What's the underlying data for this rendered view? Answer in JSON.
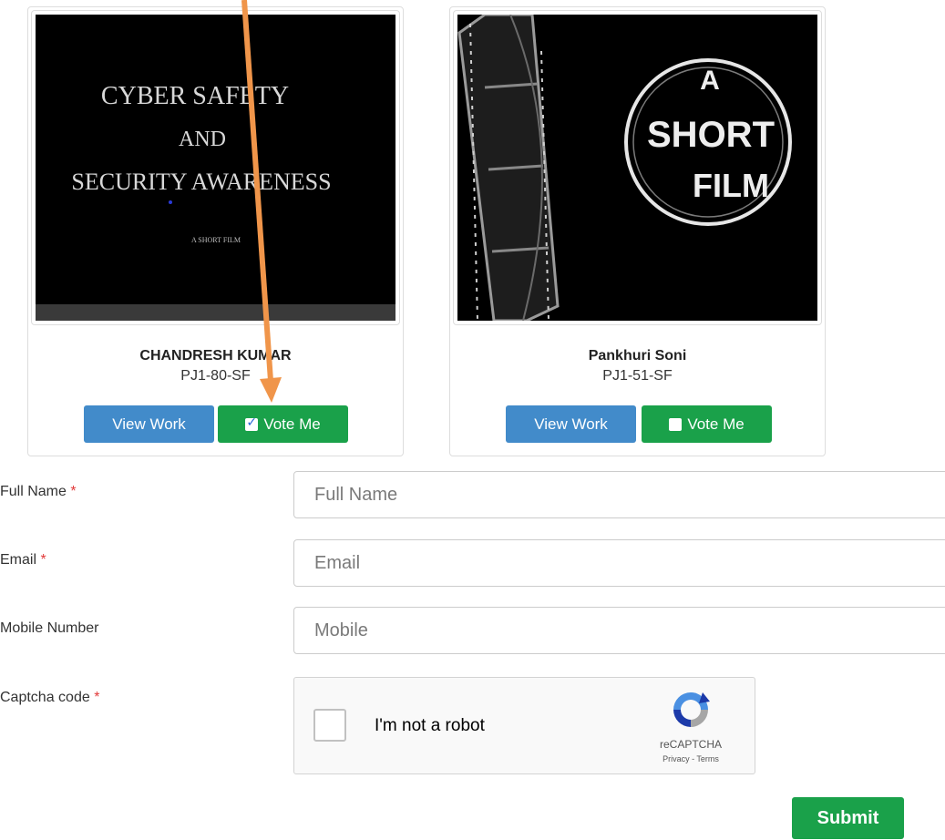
{
  "entries": [
    {
      "name": "CHANDRESH KUMAR",
      "code": "PJ1-80-SF",
      "view_label": "View Work",
      "vote_label": "Vote Me",
      "vote_checked": true,
      "thumb_text": {
        "line1": "CYBER SAFETY",
        "line2": "AND",
        "line3": "SECURITY AWARENESS",
        "line4": "A SHORT FILM"
      }
    },
    {
      "name": "Pankhuri Soni",
      "code": "PJ1-51-SF",
      "view_label": "View Work",
      "vote_label": "Vote Me",
      "vote_checked": false,
      "thumb_text": {
        "line1": "A",
        "line2": "SHORT",
        "line3": "FILM"
      }
    }
  ],
  "form": {
    "full_name": {
      "label": "Full Name",
      "required_mark": "*",
      "placeholder": "Full Name"
    },
    "email": {
      "label": "Email",
      "required_mark": "*",
      "placeholder": "Email"
    },
    "mobile": {
      "label": "Mobile Number",
      "placeholder": "Mobile"
    },
    "captcha": {
      "label": "Captcha code",
      "required_mark": "*"
    },
    "submit_label": "Submit"
  },
  "recaptcha": {
    "prompt": "I'm not a robot",
    "brand": "reCAPTCHA",
    "links": "Privacy - Terms"
  },
  "colors": {
    "view_button": "#428bca",
    "vote_button": "#1aa14a",
    "submit_button": "#1aa14a",
    "annotation_arrow": "#f0954a",
    "required_mark": "#e23a3a"
  }
}
